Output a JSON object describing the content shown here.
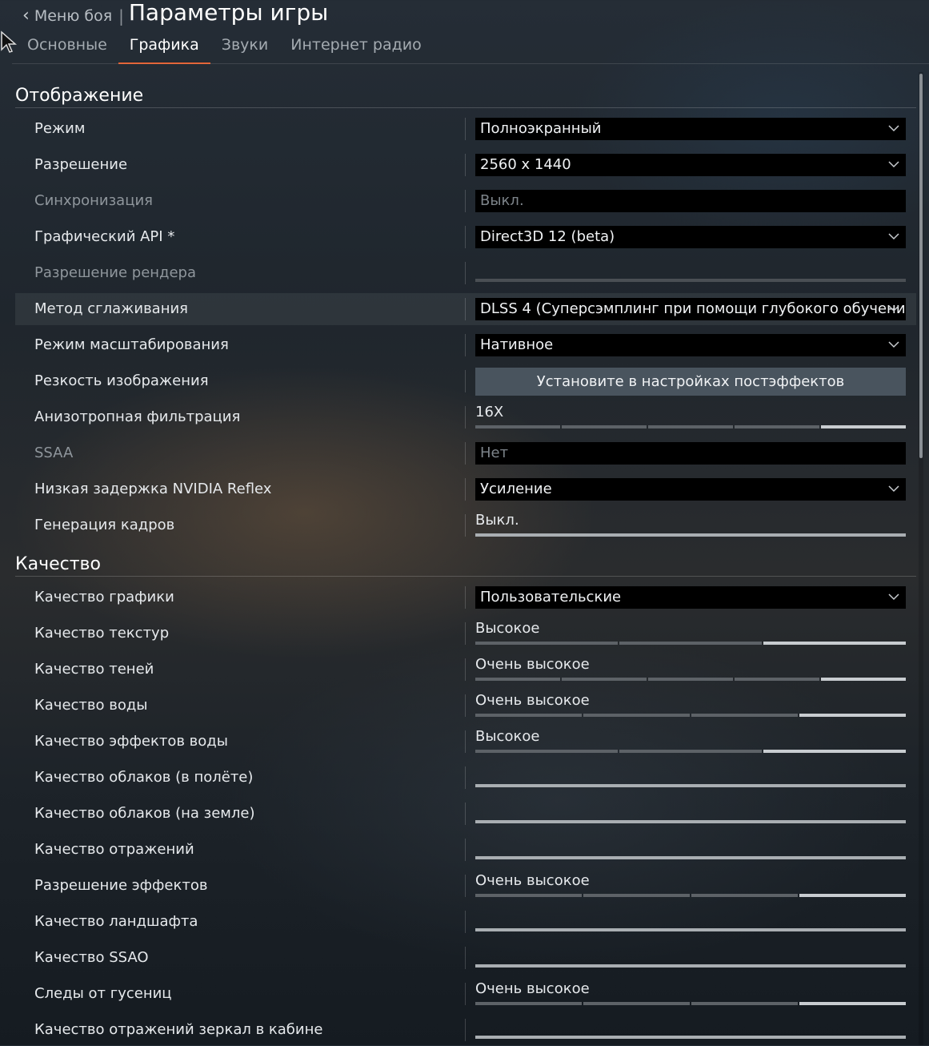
{
  "header": {
    "back_label": "Меню боя",
    "separator": "|",
    "title": "Параметры игры"
  },
  "tabs": [
    {
      "label": "Основные"
    },
    {
      "label": "Графика"
    },
    {
      "label": "Звуки"
    },
    {
      "label": "Интернет радио"
    }
  ],
  "active_tab": "Графика",
  "accent_color": "#e05a2b",
  "display": {
    "title": "Отображение",
    "rows": [
      {
        "label": "Режим",
        "value": "Полноэкранный"
      },
      {
        "label": "Разрешение",
        "value": "2560 x 1440"
      },
      {
        "label": "Синхронизация",
        "value": "Выкл."
      },
      {
        "label": "Графический API *",
        "value": "Direct3D 12 (beta)"
      },
      {
        "label": "Разрешение рендера",
        "value": ""
      },
      {
        "label": "Метод сглаживания",
        "value": "DLSS 4 (Суперсэмплинг при помощи глубокого обучения"
      },
      {
        "label": "Режим масштабирования",
        "value": "Нативное"
      },
      {
        "label": "Резкость изображения",
        "value": "Установите в настройках постэффектов"
      },
      {
        "label": "Анизотропная фильтрация",
        "value": "16X",
        "level": 5,
        "steps": 5
      },
      {
        "label": "SSAA",
        "value": "Нет"
      },
      {
        "label": "Низкая задержка NVIDIA Reflex",
        "value": "Усиление"
      },
      {
        "label": "Генерация кадров",
        "value": "Выкл."
      }
    ]
  },
  "quality": {
    "title": "Качество",
    "rows": [
      {
        "label": "Качество графики",
        "value": "Пользовательские"
      },
      {
        "label": "Качество текстур",
        "value": "Высокое",
        "level": 3,
        "steps": 3
      },
      {
        "label": "Качество теней",
        "value": "Очень высокое",
        "level": 5,
        "steps": 5
      },
      {
        "label": "Качество воды",
        "value": "Очень высокое",
        "level": 4,
        "steps": 4
      },
      {
        "label": "Качество эффектов воды",
        "value": "Высокое",
        "level": 3,
        "steps": 3
      },
      {
        "label": "Качество облаков (в полёте)",
        "value": ""
      },
      {
        "label": "Качество облаков (на земле)",
        "value": ""
      },
      {
        "label": "Качество отражений",
        "value": ""
      },
      {
        "label": "Разрешение эффектов",
        "value": "Очень высокое",
        "level": 4,
        "steps": 4
      },
      {
        "label": "Качество ландшафта",
        "value": ""
      },
      {
        "label": "Качество SSAO",
        "value": ""
      },
      {
        "label": "Следы от гусениц",
        "value": "Очень высокое",
        "level": 4,
        "steps": 4
      },
      {
        "label": "Качество отражений зеркал в кабине",
        "value": ""
      }
    ]
  }
}
